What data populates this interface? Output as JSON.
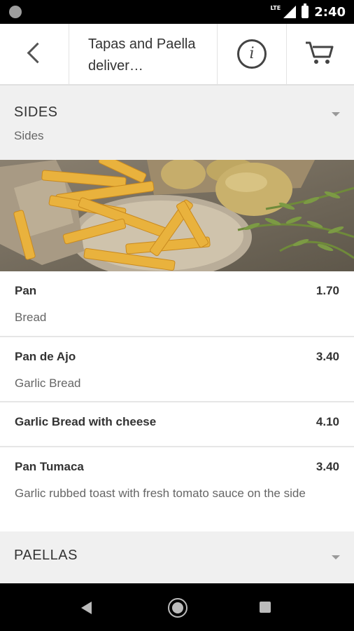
{
  "status": {
    "time": "2:40",
    "network": "LTE"
  },
  "header": {
    "title": "Tapas and Paella deliver…"
  },
  "icons": {
    "back": "back-arrow-icon",
    "info": "info-icon",
    "cart": "cart-icon"
  },
  "sections": [
    {
      "name": "SIDES",
      "subtitle": "Sides"
    },
    {
      "name": "PAELLAS"
    }
  ],
  "items": [
    {
      "name": "Pan",
      "price": "1.70",
      "description": "Bread"
    },
    {
      "name": "Pan de Ajo",
      "price": "3.40",
      "description": "Garlic Bread"
    },
    {
      "name": "Garlic Bread with cheese",
      "price": "4.10",
      "description": ""
    },
    {
      "name": "Pan Tumaca",
      "price": "3.40",
      "description": "Garlic rubbed toast with fresh tomato sauce on the side"
    }
  ],
  "colors": {
    "section_bg": "#f0f0f0",
    "text": "#333333",
    "subtext": "#666666"
  }
}
